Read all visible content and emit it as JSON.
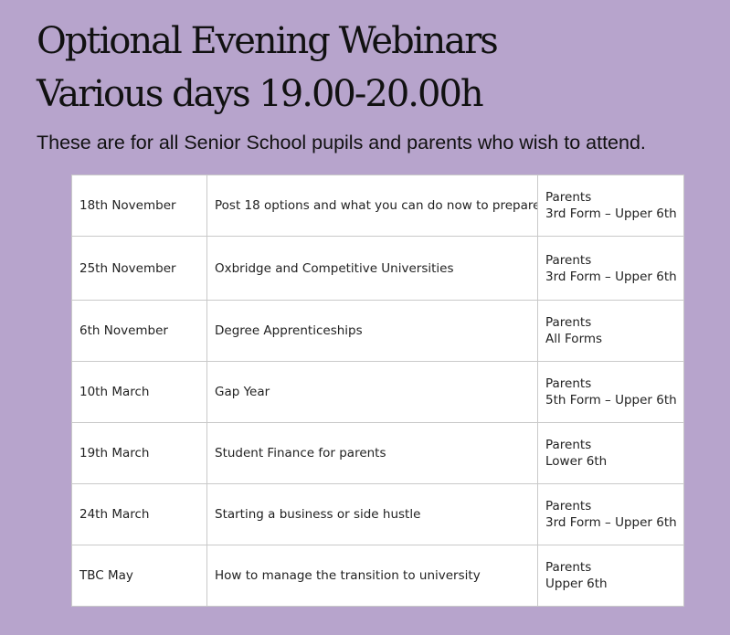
{
  "header": {
    "title_line1": "Optional Evening Webinars",
    "title_line2": "Various days 19.00-20.00h",
    "subtitle": "These are for all Senior School pupils and parents who wish to attend."
  },
  "schedule": {
    "rows": [
      {
        "date": "18th November",
        "topic": "Post 18 options and what you can do now to prepare",
        "audience": "Parents",
        "forms": "3rd Form – Upper 6th"
      },
      {
        "date": "25th November",
        "topic": "Oxbridge and Competitive Universities",
        "audience": "Parents",
        "forms": "3rd Form – Upper 6th"
      },
      {
        "date": "6th November",
        "topic": "Degree Apprenticeships",
        "audience": "Parents",
        "forms": "All Forms"
      },
      {
        "date": "10th March",
        "topic": "Gap Year",
        "audience": "Parents",
        "forms": "5th Form – Upper 6th"
      },
      {
        "date": "19th March",
        "topic": "Student Finance for parents",
        "audience": "Parents",
        "forms": "Lower 6th"
      },
      {
        "date": "24th March",
        "topic": "Starting a business or side hustle",
        "audience": "Parents",
        "forms": "3rd Form – Upper 6th"
      },
      {
        "date": "TBC May",
        "topic": "How to manage the transition to university",
        "audience": "Parents",
        "forms": "Upper 6th"
      }
    ]
  },
  "colors": {
    "background": "#b7a4cc",
    "table_background": "#ffffff",
    "border": "#c9c9c9",
    "text": "#111111"
  }
}
